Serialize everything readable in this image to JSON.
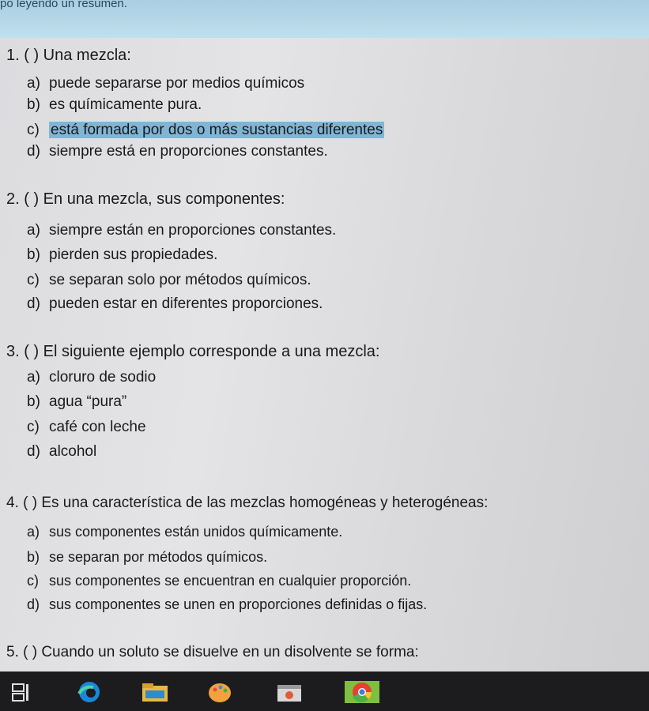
{
  "header": {
    "hint": "po leyendo un resumen."
  },
  "questions": [
    {
      "stem": "1. (      ) Una mezcla:",
      "options": [
        {
          "letter": "a)",
          "text": "puede separarse por medios químicos"
        },
        {
          "letter": "b)",
          "text": "es químicamente pura."
        },
        {
          "letter": "c)",
          "text": "está formada por dos o más sustancias diferentes"
        },
        {
          "letter": "d)",
          "text": "siempre está  en proporciones constantes."
        }
      ]
    },
    {
      "stem": "2. (      ) En una mezcla, sus componentes:",
      "options": [
        {
          "letter": "a)",
          "text": "siempre están en proporciones constantes."
        },
        {
          "letter": "b)",
          "text": "pierden sus propiedades."
        },
        {
          "letter": "c)",
          "text": "se separan solo por métodos químicos."
        },
        {
          "letter": "d)",
          "text": "pueden estar en diferentes proporciones."
        }
      ]
    },
    {
      "stem": "3. (        ) El siguiente ejemplo corresponde a una mezcla:",
      "options": [
        {
          "letter": "a)",
          "text": "cloruro de sodio"
        },
        {
          "letter": "b)",
          "text": "agua “pura”"
        },
        {
          "letter": "c)",
          "text": "café con leche"
        },
        {
          "letter": "d)",
          "text": "alcohol"
        }
      ]
    },
    {
      "stem": "4. (        ) Es una característica de las mezclas homogéneas y heterogéneas:",
      "options": [
        {
          "letter": "a)",
          "text": "sus componentes están unidos químicamente."
        },
        {
          "letter": "b)",
          "text": "se separan por métodos químicos."
        },
        {
          "letter": "c)",
          "text": "sus componentes se encuentran en cualquier proporción."
        },
        {
          "letter": "d)",
          "text": "sus componentes se unen en proporciones definidas o fijas."
        }
      ]
    },
    {
      "stem": "5. (        ) Cuando un soluto se disuelve en un disolvente se forma:",
      "options": []
    }
  ],
  "highlight_color": "#7fb6d6",
  "taskbar": {
    "icons": [
      "task-view-icon",
      "edge-icon",
      "file-explorer-icon",
      "paint-icon",
      "store-icon",
      "chrome-icon"
    ]
  }
}
